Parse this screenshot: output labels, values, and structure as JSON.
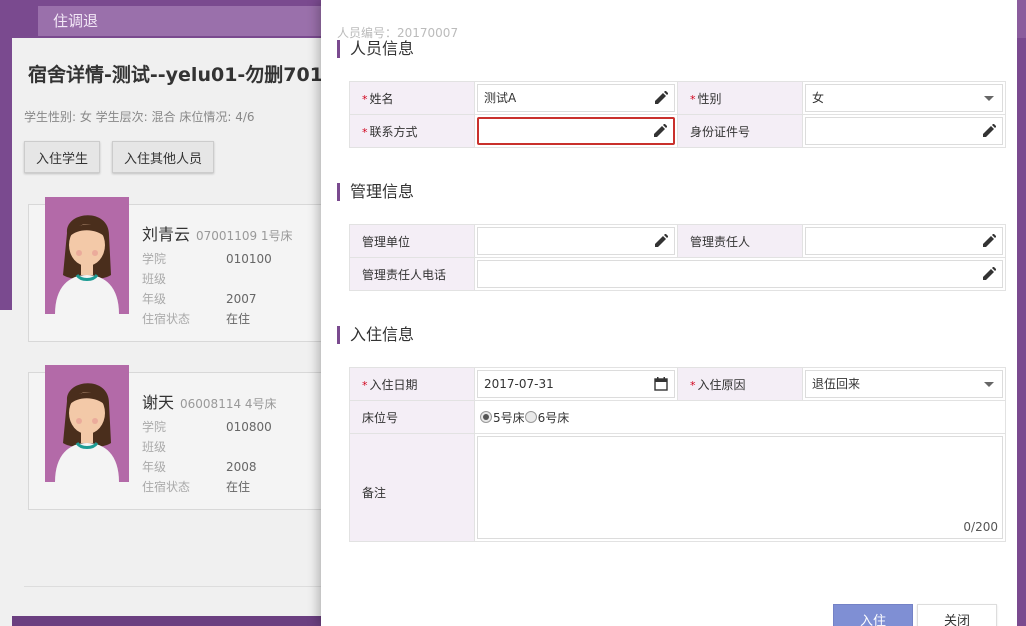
{
  "background": {
    "app_title": "",
    "tab_label": "住调退",
    "panel_title": "宿舍详情-测试--yelu01-勿删701",
    "panel_subtitle": "学生性别: 女 学生层次: 混合 床位情况: 4/6",
    "buttons": {
      "checkin_student": "入住学生",
      "checkin_other": "入住其他人员"
    },
    "residents": [
      {
        "name": "刘青云",
        "code": "07001109 1号床",
        "rows": [
          {
            "k": "学院",
            "v": "010100"
          },
          {
            "k": "班级",
            "v": ""
          },
          {
            "k": "年级",
            "v": "2007"
          },
          {
            "k": "住宿状态",
            "v": "在住"
          }
        ]
      },
      {
        "name": "谢天",
        "code": "06008114 4号床",
        "rows": [
          {
            "k": "学院",
            "v": "010800"
          },
          {
            "k": "班级",
            "v": ""
          },
          {
            "k": "年级",
            "v": "2008"
          },
          {
            "k": "住宿状态",
            "v": "在住"
          }
        ]
      }
    ]
  },
  "drawer": {
    "person_no": "人员编号：20170007",
    "sections": {
      "person": "人员信息",
      "management": "管理信息",
      "checkin": "入住信息"
    },
    "person": {
      "name_label": "姓名",
      "name_value": "测试A",
      "gender_label": "性别",
      "gender_value": "女",
      "contact_label": "联系方式",
      "contact_value": "",
      "id_label": "身份证件号",
      "id_value": ""
    },
    "management": {
      "unit_label": "管理单位",
      "unit_value": "",
      "owner_label": "管理责任人",
      "owner_value": "",
      "phone_label": "管理责任人电话",
      "phone_value": ""
    },
    "checkin": {
      "date_label": "入住日期",
      "date_value": "2017-07-31",
      "reason_label": "入住原因",
      "reason_value": "退伍回来",
      "bed_label": "床位号",
      "bed_options": [
        "5号床",
        "6号床"
      ],
      "bed_selected": "5号床",
      "notes_label": "备注",
      "notes_counter": "0/200"
    },
    "actions": {
      "submit": "入住",
      "close": "关闭"
    }
  },
  "colors": {
    "brand_purple": "#7a4a8f",
    "primary_button": "#7f8fd4",
    "required_mark": "#d0021b",
    "error_border": "#c9302c"
  }
}
